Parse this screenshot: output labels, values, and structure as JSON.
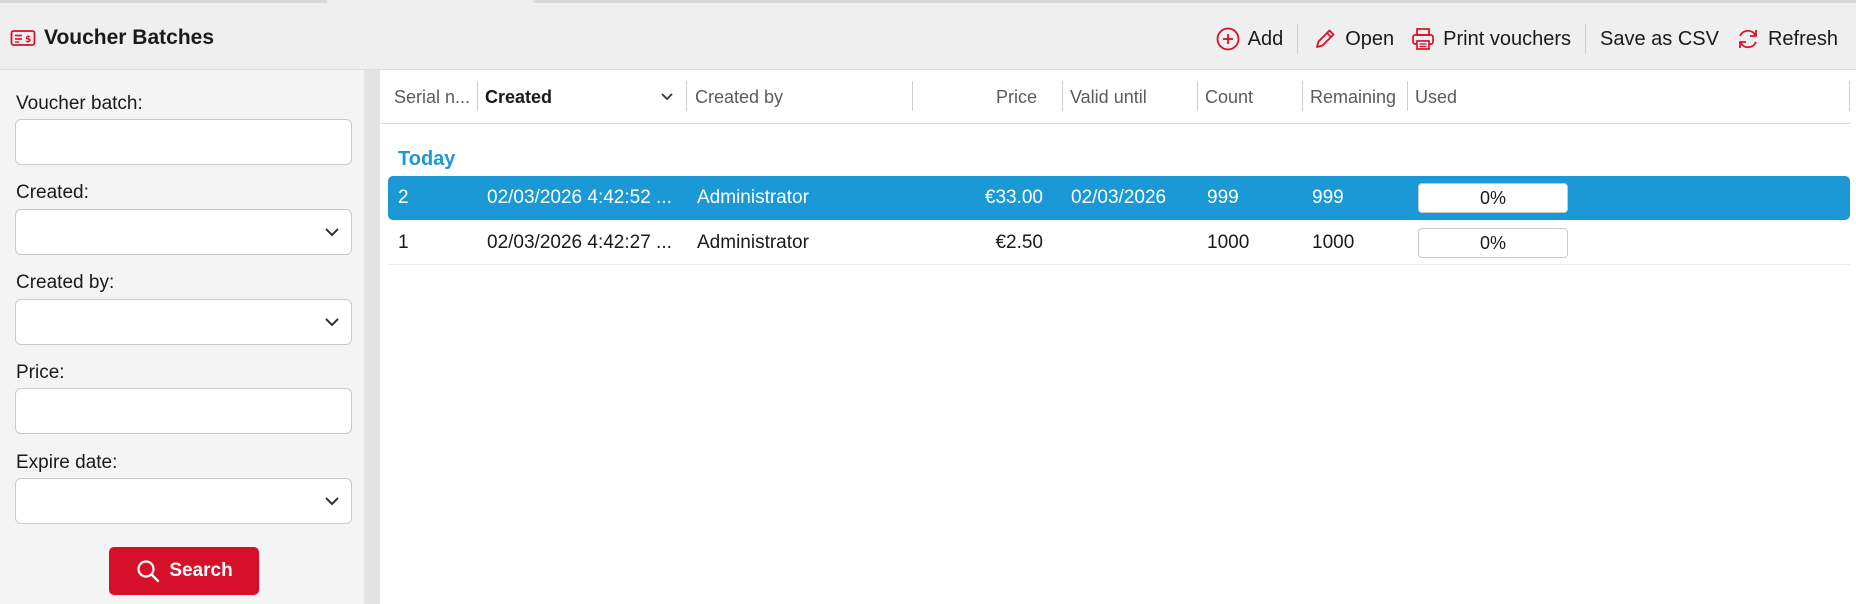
{
  "header": {
    "title": "Voucher Batches",
    "toolbar": {
      "add": "Add",
      "open": "Open",
      "print": "Print vouchers",
      "save_csv": "Save as CSV",
      "refresh": "Refresh"
    }
  },
  "filters": {
    "voucher_batch": {
      "label": "Voucher batch:",
      "value": ""
    },
    "created": {
      "label": "Created:",
      "value": ""
    },
    "created_by": {
      "label": "Created by:",
      "value": ""
    },
    "price": {
      "label": "Price:",
      "value": ""
    },
    "expire_date": {
      "label": "Expire date:",
      "value": ""
    },
    "search_label": "Search"
  },
  "grid": {
    "columns": [
      "Serial n...",
      "Created",
      "Created by",
      "Price",
      "Valid until",
      "Count",
      "Remaining",
      "Used"
    ],
    "sorted_column": "Created",
    "group": "Today",
    "rows": [
      {
        "serial": "2",
        "created": "02/03/2026 4:42:52 ...",
        "created_by": "Administrator",
        "price": "€33.00",
        "valid_until": "02/03/2026",
        "count": "999",
        "remaining": "999",
        "used": "0%",
        "used_fraction": 0,
        "selected": true
      },
      {
        "serial": "1",
        "created": "02/03/2026 4:42:27 ...",
        "created_by": "Administrator",
        "price": "€2.50",
        "valid_until": "",
        "count": "1000",
        "remaining": "1000",
        "used": "0%",
        "used_fraction": 0,
        "selected": false
      }
    ]
  },
  "colors": {
    "accent_red": "#d6102b",
    "selection_blue": "#1b98d6",
    "header_bg": "#efefef"
  },
  "icons": {
    "title": "voucher-ticket-icon",
    "add": "plus-circle-icon",
    "open": "pencil-icon",
    "print": "printer-icon",
    "refresh": "refresh-icon",
    "search": "search-icon",
    "dropdown": "chevron-down-icon"
  }
}
